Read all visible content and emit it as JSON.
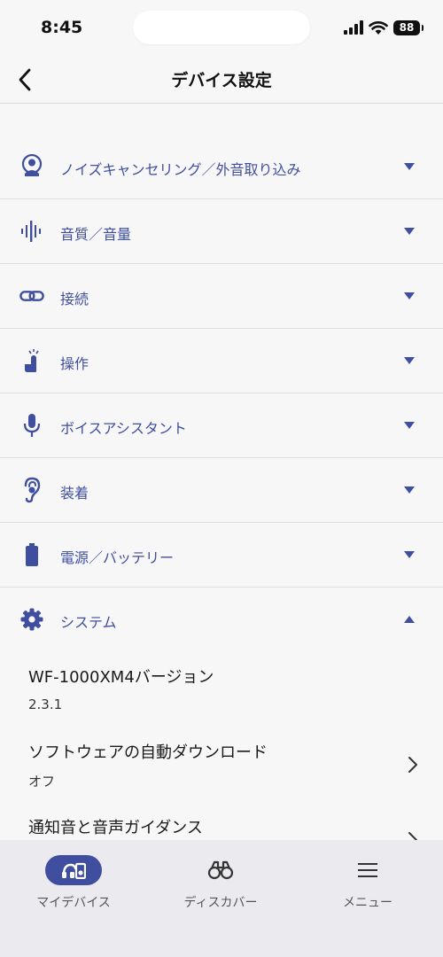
{
  "status_bar": {
    "time": "8:45",
    "battery": "88"
  },
  "header": {
    "title": "デバイス設定"
  },
  "sections": [
    {
      "label": "ノイズキャンセリング／外音取り込み",
      "icon": "person-noise-icon",
      "expanded": false
    },
    {
      "label": "音質／音量",
      "icon": "soundwave-icon",
      "expanded": false
    },
    {
      "label": "接続",
      "icon": "link-icon",
      "expanded": false
    },
    {
      "label": "操作",
      "icon": "tap-icon",
      "expanded": false
    },
    {
      "label": "ボイスアシスタント",
      "icon": "microphone-icon",
      "expanded": false
    },
    {
      "label": "装着",
      "icon": "ear-icon",
      "expanded": false
    },
    {
      "label": "電源／バッテリー",
      "icon": "battery-icon",
      "expanded": false
    },
    {
      "label": "システム",
      "icon": "gear-icon",
      "expanded": true
    }
  ],
  "system_items": [
    {
      "title": "WF-1000XM4バージョン",
      "value": "2.3.1"
    },
    {
      "title": "ソフトウェアの自動ダウンロード",
      "value": "オフ"
    },
    {
      "title": "通知音と音声ガイダンス",
      "value": ""
    }
  ],
  "bottom_nav": [
    {
      "label": "マイデバイス",
      "icon": "headphones-device-icon",
      "active": true
    },
    {
      "label": "ディスカバー",
      "icon": "binoculars-icon",
      "active": false
    },
    {
      "label": "メニュー",
      "icon": "menu-icon",
      "active": false
    }
  ],
  "colors": {
    "accent": "#3f4e9e",
    "background": "#f7f7f7",
    "nav_background": "#ebebef"
  }
}
